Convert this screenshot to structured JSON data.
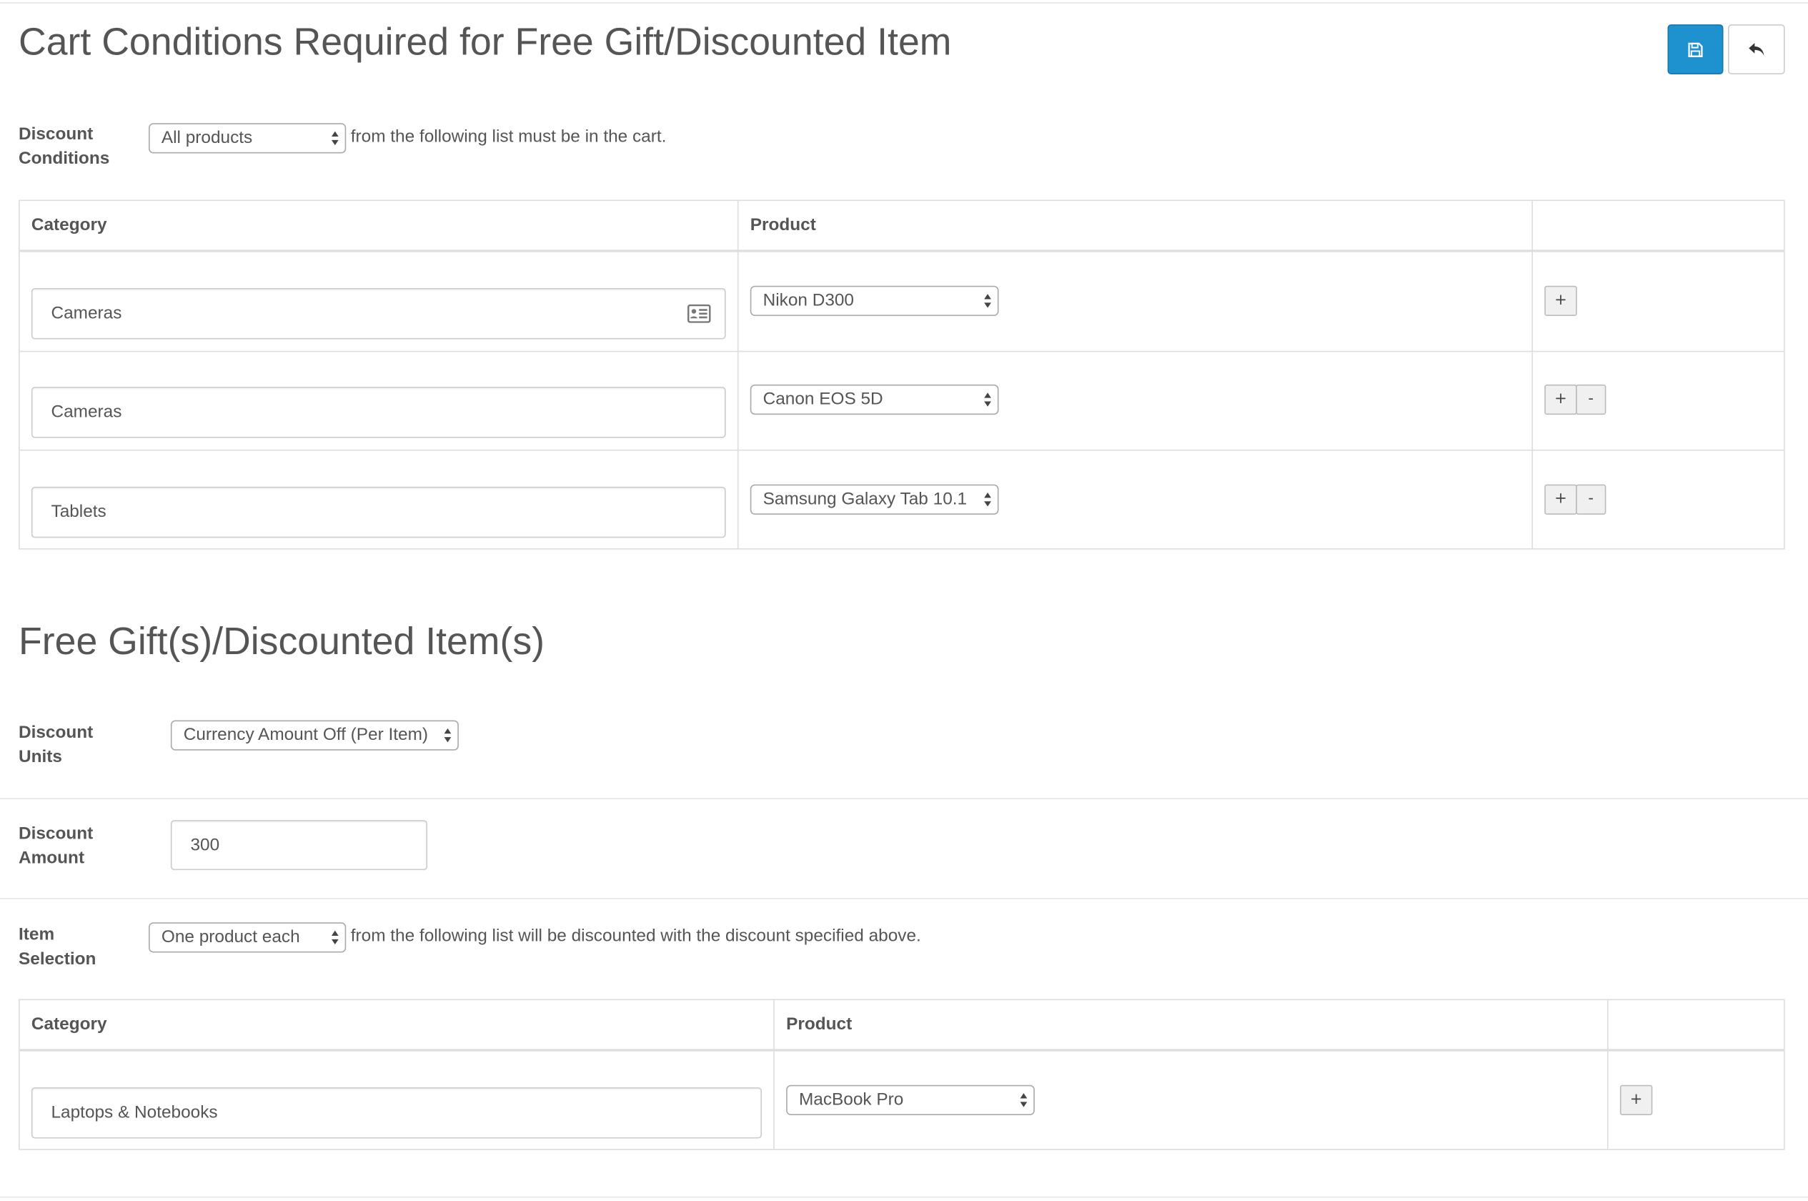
{
  "conditions": {
    "title": "Cart Conditions Required for Free Gift/Discounted Item",
    "label": "Discount\nConditions",
    "select_value": "All products",
    "tail_text": "from the following list must be in the cart.",
    "headers": {
      "category": "Category",
      "product": "Product"
    },
    "rows": [
      {
        "category": "Cameras",
        "product": "Nikon D300"
      },
      {
        "category": "Cameras",
        "product": "Canon EOS 5D"
      },
      {
        "category": "Tablets",
        "product": "Samsung Galaxy Tab 10.1"
      }
    ]
  },
  "gifts": {
    "title": "Free Gift(s)/Discounted Item(s)",
    "units_label": "Discount\nUnits",
    "units_value": "Currency Amount Off (Per Item)",
    "amount_label": "Discount\nAmount",
    "amount_value": "300",
    "selection_label": "Item\nSelection",
    "selection_value": "One product each",
    "selection_tail": "from the following list will be discounted with the discount specified above.",
    "headers": {
      "category": "Category",
      "product": "Product"
    },
    "rows": [
      {
        "category": "Laptops & Notebooks",
        "product": "MacBook Pro"
      }
    ]
  },
  "buttons": {
    "add": "+",
    "remove": "-"
  },
  "colors": {
    "primary": "#1e91cf"
  }
}
